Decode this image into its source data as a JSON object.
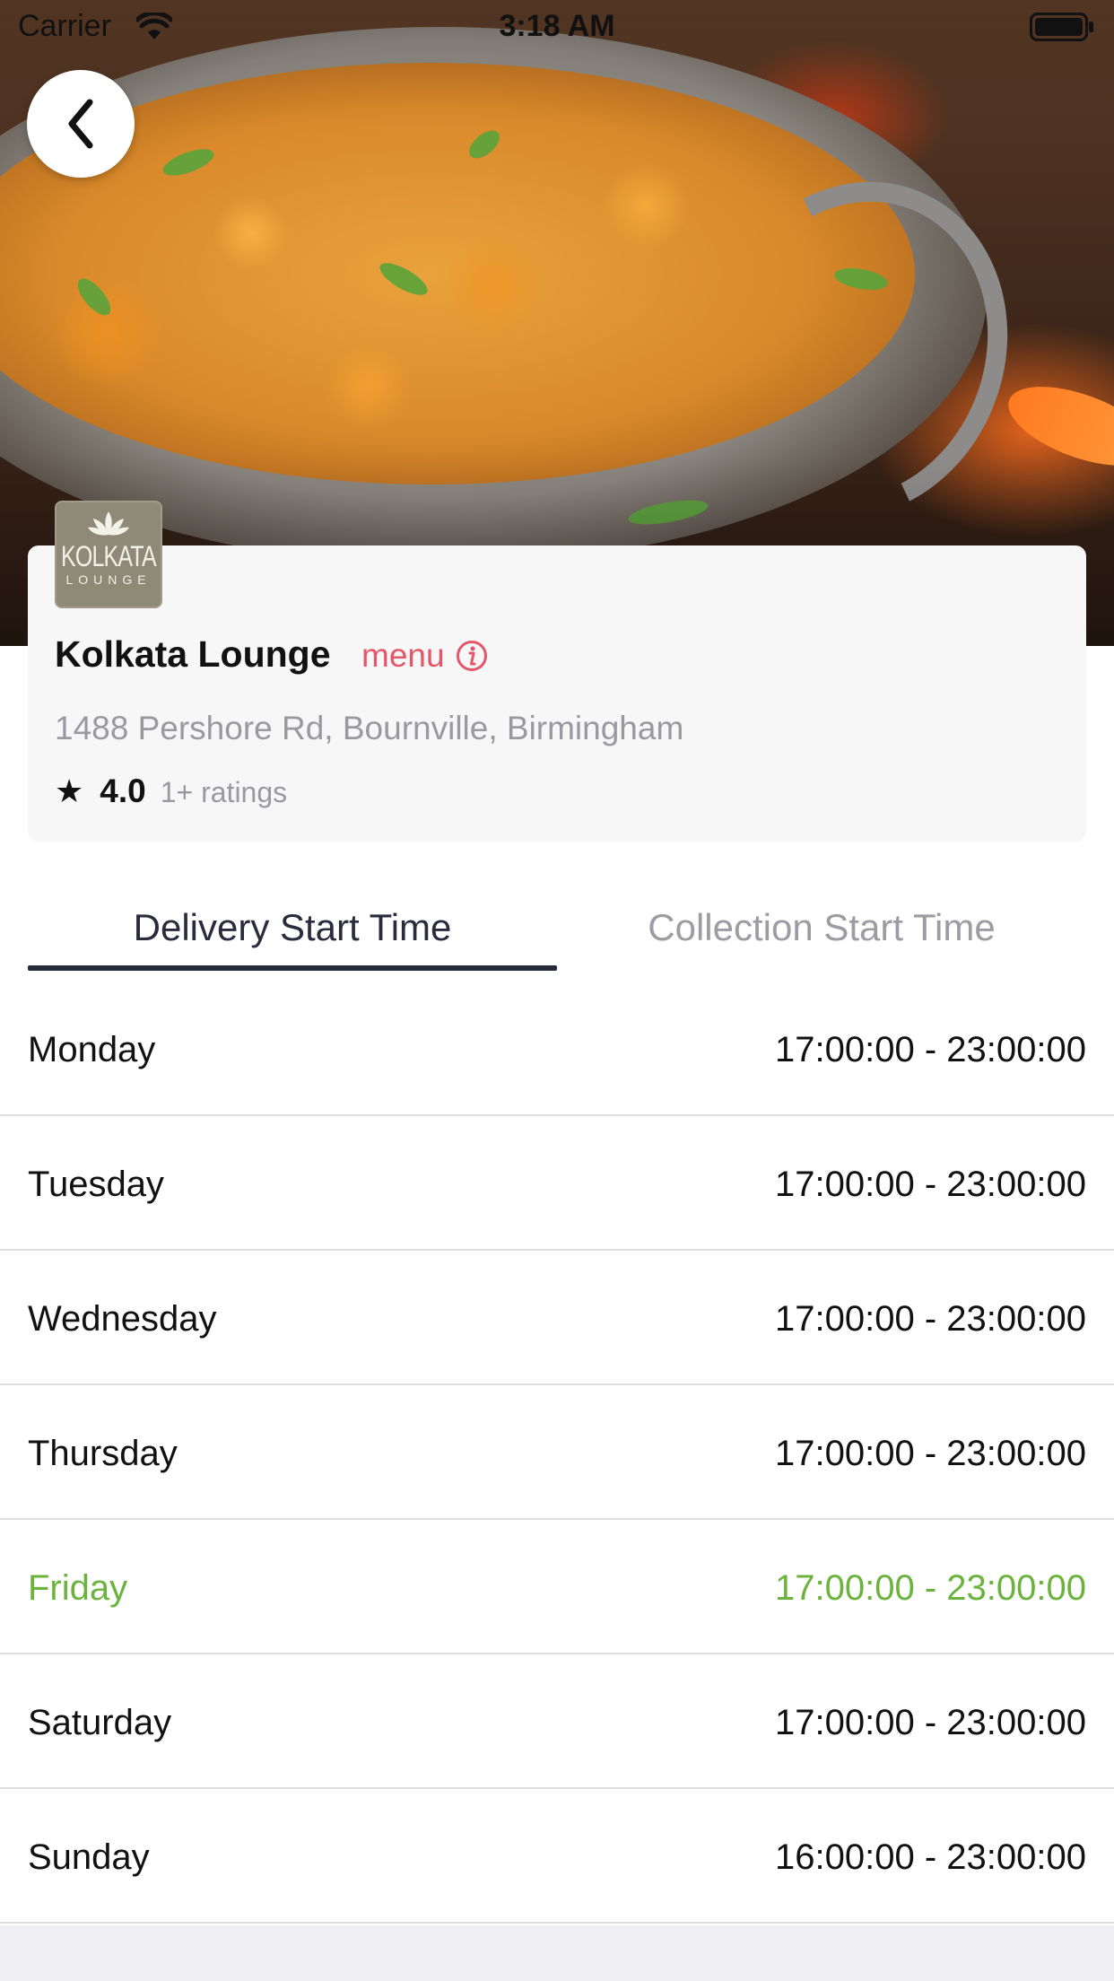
{
  "status_bar": {
    "carrier": "Carrier",
    "time": "3:18 AM"
  },
  "back_button": {
    "icon": "chevron-left-icon"
  },
  "restaurant": {
    "name": "Kolkata Lounge",
    "menu_label": "menu",
    "address": "1488 Pershore Rd, Bournville, Birmingham",
    "rating": "4.0",
    "rating_count": "1+ ratings",
    "logo": {
      "name": "KOLKATA",
      "sub": "LOUNGE"
    }
  },
  "tabs": [
    {
      "label": "Delivery Start Time",
      "active": true
    },
    {
      "label": "Collection Start Time",
      "active": false
    }
  ],
  "schedule": [
    {
      "day": "Monday",
      "hours": "17:00:00 - 23:00:00",
      "highlight": false
    },
    {
      "day": "Tuesday",
      "hours": "17:00:00 - 23:00:00",
      "highlight": false
    },
    {
      "day": "Wednesday",
      "hours": "17:00:00 - 23:00:00",
      "highlight": false
    },
    {
      "day": "Thursday",
      "hours": "17:00:00 - 23:00:00",
      "highlight": false
    },
    {
      "day": "Friday",
      "hours": "17:00:00 - 23:00:00",
      "highlight": true
    },
    {
      "day": "Saturday",
      "hours": "17:00:00 - 23:00:00",
      "highlight": false
    },
    {
      "day": "Sunday",
      "hours": "16:00:00 - 23:00:00",
      "highlight": false
    }
  ],
  "colors": {
    "menu_accent": "#e5566b",
    "today_highlight": "#6cb33e",
    "tab_underline": "#262a3b"
  }
}
